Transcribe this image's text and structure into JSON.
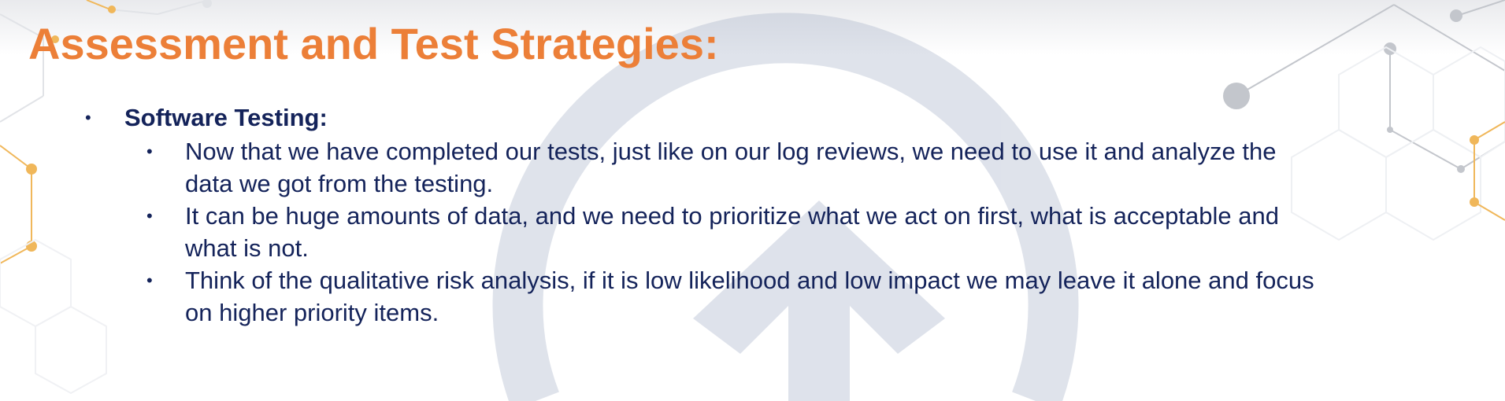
{
  "slide": {
    "title": "Assessment and Test Strategies:",
    "bullet_char": "•",
    "section": {
      "heading": "Software Testing:",
      "items": [
        {
          "lines": [
            "Now that we have completed our tests, just like on our log reviews, we need to use it and analyze the",
            "data we got from the testing."
          ]
        },
        {
          "lines": [
            "It can be huge amounts of data, and we need to prioritize what we act on first, what is acceptable and",
            "what is not."
          ]
        },
        {
          "lines": [
            "Think of the qualitative risk analysis, if it is low likelihood and low impact we may leave it alone and focus",
            "on higher priority items."
          ]
        }
      ]
    }
  },
  "colors": {
    "title": "#ec7f38",
    "body_text": "#14235a",
    "watermark": "#c9d1df",
    "accent_orange": "#f0b75a",
    "network_gray": "#c3c6cc"
  },
  "decorations": {
    "watermark": "up-arrow-circle-logo",
    "network": "hexagon-node-network"
  }
}
